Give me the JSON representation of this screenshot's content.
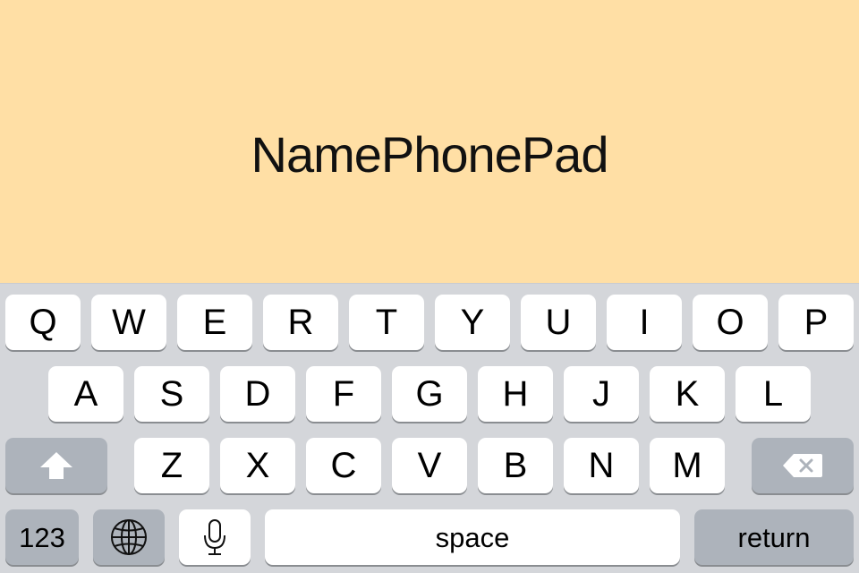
{
  "screen": {
    "title": "NamePhonePad",
    "background_color": "#FFDFA5"
  },
  "keyboard": {
    "row1": [
      "Q",
      "W",
      "E",
      "R",
      "T",
      "Y",
      "U",
      "I",
      "O",
      "P"
    ],
    "row2": [
      "A",
      "S",
      "D",
      "F",
      "G",
      "H",
      "J",
      "K",
      "L"
    ],
    "row3": [
      "Z",
      "X",
      "C",
      "V",
      "B",
      "N",
      "M"
    ],
    "shift_icon": "shift-arrow-icon",
    "delete_icon": "backspace-icon",
    "numbers_label": "123",
    "globe_icon": "globe-icon",
    "mic_icon": "microphone-icon",
    "space_label": "space",
    "return_label": "return",
    "colors": {
      "keyboard_bg": "#D4D6DA",
      "key_bg": "#FFFFFF",
      "function_key_bg": "#ADB3BB"
    }
  }
}
